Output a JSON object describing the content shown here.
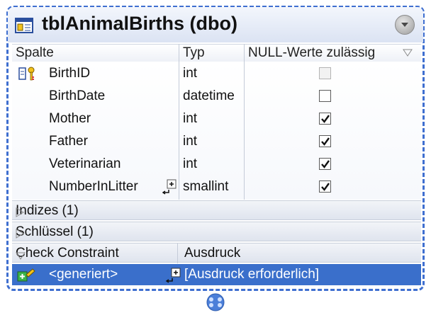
{
  "table": {
    "title": "tblAnimalBirths (dbo)",
    "header": {
      "col1": "Spalte",
      "col2": "Typ",
      "col3": "NULL-Werte zulässig"
    },
    "columns": [
      {
        "name": "BirthID",
        "type": "int",
        "nullable": false,
        "disabled": true,
        "primary_key": true
      },
      {
        "name": "BirthDate",
        "type": "datetime",
        "nullable": false,
        "disabled": false
      },
      {
        "name": "Mother",
        "type": "int",
        "nullable": true,
        "disabled": false
      },
      {
        "name": "Father",
        "type": "int",
        "nullable": true,
        "disabled": false
      },
      {
        "name": "Veterinarian",
        "type": "int",
        "nullable": true,
        "disabled": false
      },
      {
        "name": "NumberInLitter",
        "type": "smallint",
        "nullable": true,
        "disabled": false,
        "has_size_button": true
      }
    ],
    "sections": {
      "indexes": "Indizes (1)",
      "keys": "Schlüssel (1)"
    },
    "check_constraint": {
      "label": "Check Constraint",
      "expr_header": "Ausdruck",
      "row_name": "<generiert>",
      "row_expr": "[Ausdruck erforderlich]"
    }
  },
  "colors": {
    "frame": "#3f6fd0",
    "selected": "#3a6fcb"
  }
}
